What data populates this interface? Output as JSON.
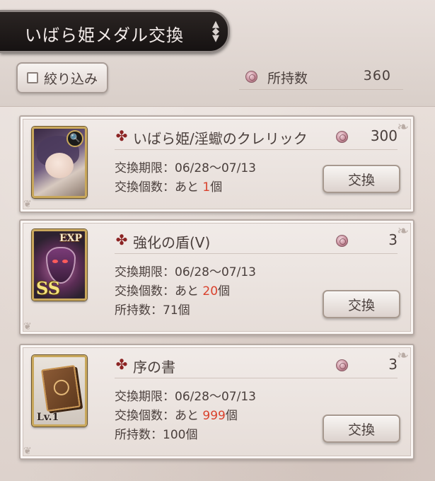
{
  "header": {
    "title": "いばら姫メダル交換",
    "toggle_icon": "diamond-arrows-icon",
    "filter_label": "絞り込み",
    "owned_label": "所持数",
    "owned_value": "360"
  },
  "items": [
    {
      "name": "いばら姫/淫蠍のクレリック",
      "price": "300",
      "period_label": "交換期限：",
      "period": "06/28〜07/13",
      "count_label": "交換個数：あと ",
      "count": "1",
      "count_unit": "個",
      "owned": "",
      "button": "交換",
      "thumb": "cleric-portrait"
    },
    {
      "name": "強化の盾(Ⅴ)",
      "price": "3",
      "period_label": "交換期限：",
      "period": "06/28〜07/13",
      "count_label": "交換個数：あと ",
      "count": "20",
      "count_unit": "個",
      "owned": "所持数：71個",
      "button": "交換",
      "thumb": "exp-shield",
      "badge_top": "EXP",
      "badge_bottom": "SS"
    },
    {
      "name": "序の書",
      "price": "3",
      "period_label": "交換期限：",
      "period": "06/28〜07/13",
      "count_label": "交換個数：あと ",
      "count": "999",
      "count_unit": "個",
      "owned": "所持数：100個",
      "button": "交換",
      "thumb": "book",
      "badge_bottom": "Lv.1"
    }
  ],
  "colors": {
    "remaining_count": "#d9412c",
    "cross_icon": "#8c2424",
    "title_plate": "#1d1816"
  }
}
